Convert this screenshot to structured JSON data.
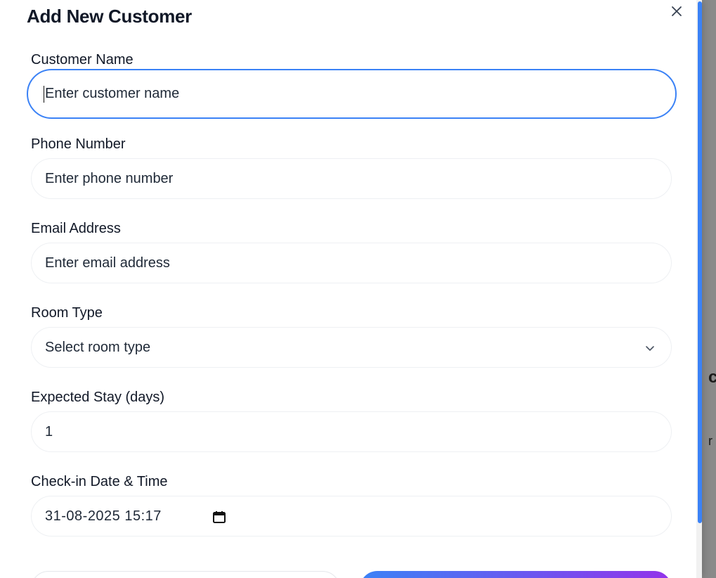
{
  "modal": {
    "title": "Add New Customer"
  },
  "fields": {
    "customer_name": {
      "label": "Customer Name",
      "placeholder": "Enter customer name"
    },
    "phone": {
      "label": "Phone Number",
      "placeholder": "Enter phone number"
    },
    "email": {
      "label": "Email Address",
      "placeholder": "Enter email address"
    },
    "room_type": {
      "label": "Room Type",
      "selected": "Select room type"
    },
    "stay": {
      "label": "Expected Stay (days)",
      "value": "1"
    },
    "checkin": {
      "label": "Check-in Date & Time",
      "value": "31-08-2025 15:17"
    }
  },
  "icons": {
    "close": "close-icon",
    "chevron": "chevron-down-icon",
    "calendar": "calendar-icon"
  },
  "colors": {
    "accent": "#3b82f6",
    "gradient_end": "#9333ea"
  }
}
